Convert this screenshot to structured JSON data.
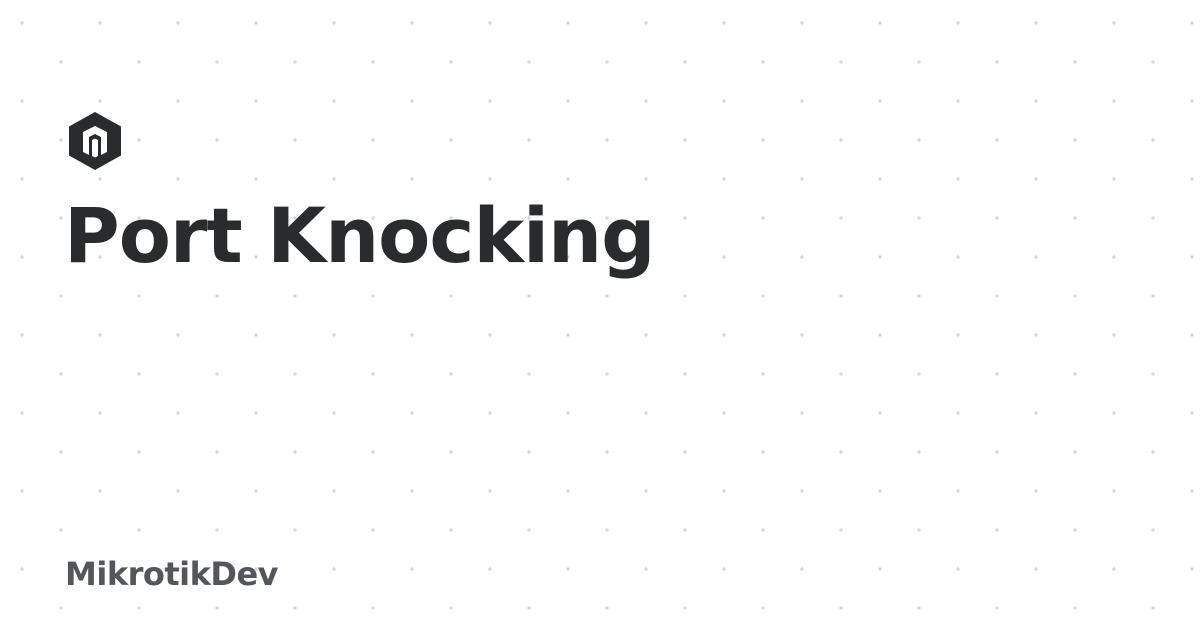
{
  "page": {
    "title": "Port Knocking",
    "brand": "MikrotikDev"
  },
  "logo": {
    "icon": "mikrotik-logo-icon",
    "color": "#2a2b2d"
  },
  "colors": {
    "background": "#ffffff",
    "dots": "#d6d6d6",
    "title": "#2a2b2d",
    "brand": "#55565a"
  }
}
